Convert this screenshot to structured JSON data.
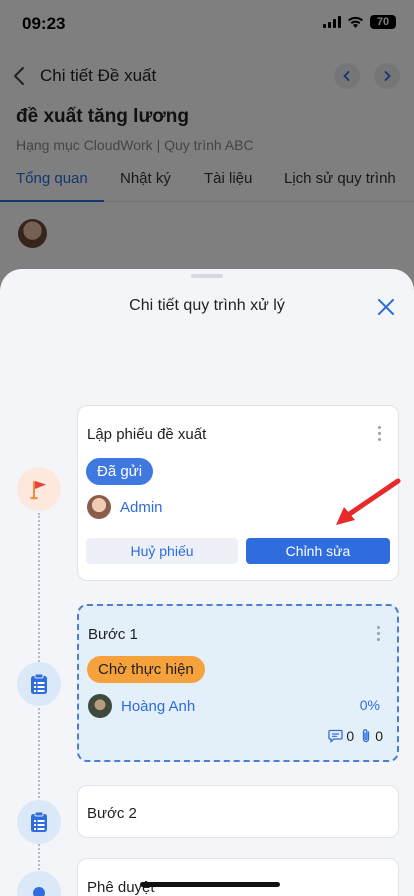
{
  "status_bar": {
    "time": "09:23",
    "battery": "70"
  },
  "nav": {
    "title": "Chi tiết Đề xuất"
  },
  "document": {
    "title": "đề xuất tăng lương",
    "subtitle": "Hạng mục CloudWork | Quy trình ABC"
  },
  "tabs": [
    {
      "label": "Tổng quan",
      "active": true
    },
    {
      "label": "Nhật ký",
      "active": false
    },
    {
      "label": "Tài liệu",
      "active": false
    },
    {
      "label": "Lịch sử quy trình",
      "active": false
    }
  ],
  "sheet": {
    "title": "Chi tiết quy trình xử lý",
    "steps": [
      {
        "title": "Lập phiếu đề xuất",
        "status": "Đã gửi",
        "assignee": "Admin",
        "actions": {
          "cancel": "Huỷ phiếu",
          "edit": "Chỉnh sửa"
        }
      },
      {
        "title": "Bước 1",
        "status": "Chờ thực hiện",
        "assignee": "Hoàng Anh",
        "progress": "0%",
        "comments": "0",
        "attachments": "0"
      },
      {
        "title": "Bước 2"
      },
      {
        "title": "Phê duyệt"
      }
    ]
  },
  "colors": {
    "accent": "#2d6cdf",
    "status_sent": "#3f78e0",
    "status_waiting": "#f5a23c",
    "annotation_arrow": "#e82a2a"
  }
}
